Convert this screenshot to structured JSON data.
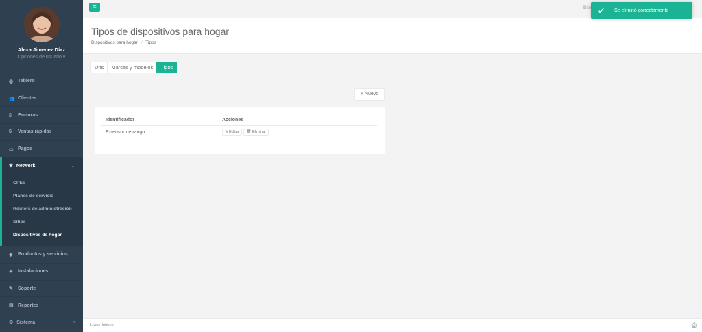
{
  "sidebar": {
    "user_name": "Alexa Jimenez Díaz",
    "user_options": "Opciones de usuario ▾",
    "items": [
      {
        "label": "Tablero",
        "icon": "dashboard-icon",
        "glyph": "◍"
      },
      {
        "label": "Clientes",
        "icon": "users-icon",
        "glyph": "👥"
      },
      {
        "label": "Facturas",
        "icon": "file-icon",
        "glyph": "▯"
      },
      {
        "label": "Ventas rápidas",
        "icon": "dollar-icon",
        "glyph": "$"
      },
      {
        "label": "Pagos",
        "icon": "money-icon",
        "glyph": "▭"
      }
    ],
    "network": {
      "label": "Network",
      "icon": "network-icon",
      "glyph": "✻",
      "chevron": "⌄"
    },
    "network_subitems": [
      {
        "label": "CPEs"
      },
      {
        "label": "Planes de servicio"
      },
      {
        "label": "Routers de administración"
      },
      {
        "label": "Sitios"
      },
      {
        "label": "Dispositivos de hogar"
      }
    ],
    "bottom_items": [
      {
        "label": "Productos y servicios",
        "icon": "tag-icon",
        "glyph": "◆"
      },
      {
        "label": "Instalaciones",
        "icon": "install-icon",
        "glyph": "✦"
      },
      {
        "label": "Soporte",
        "icon": "wrench-icon",
        "glyph": "✎"
      },
      {
        "label": "Reportes",
        "icon": "reports-icon",
        "glyph": "▤"
      },
      {
        "label": "Sistema",
        "icon": "cogs-icon",
        "glyph": "⚙",
        "chevron": "‹"
      }
    ]
  },
  "topbar": {
    "menu_glyph": "≡",
    "welcome": "Bien"
  },
  "heading": {
    "title": "Tipos de dispositivos para hogar",
    "breadcrumb_parent": "Dispositivos para hogar",
    "breadcrumb_sep": "/",
    "breadcrumb_current": "Tipos"
  },
  "tabs": [
    {
      "label": "Dhs",
      "active": false
    },
    {
      "label": "Marcas y modelos",
      "active": false
    },
    {
      "label": "Tipos",
      "active": true
    }
  ],
  "toolbar": {
    "new_label": "+ Nuevo"
  },
  "table": {
    "headers": [
      "Identificador",
      "Acciones"
    ],
    "rows": [
      {
        "identifier": "Extensor de rango",
        "edit_label": "✎ Editar",
        "delete_label": "🗑 Eliminar"
      }
    ]
  },
  "toast": {
    "message": "Se eliminó correctamente",
    "icon": "check-icon",
    "glyph": "✔"
  },
  "footer": {
    "text": "Livaur Internet",
    "icon": "printer-icon",
    "glyph": "⎙"
  },
  "colors": {
    "accent": "#1ab394",
    "sidebar": "#2f4050"
  }
}
